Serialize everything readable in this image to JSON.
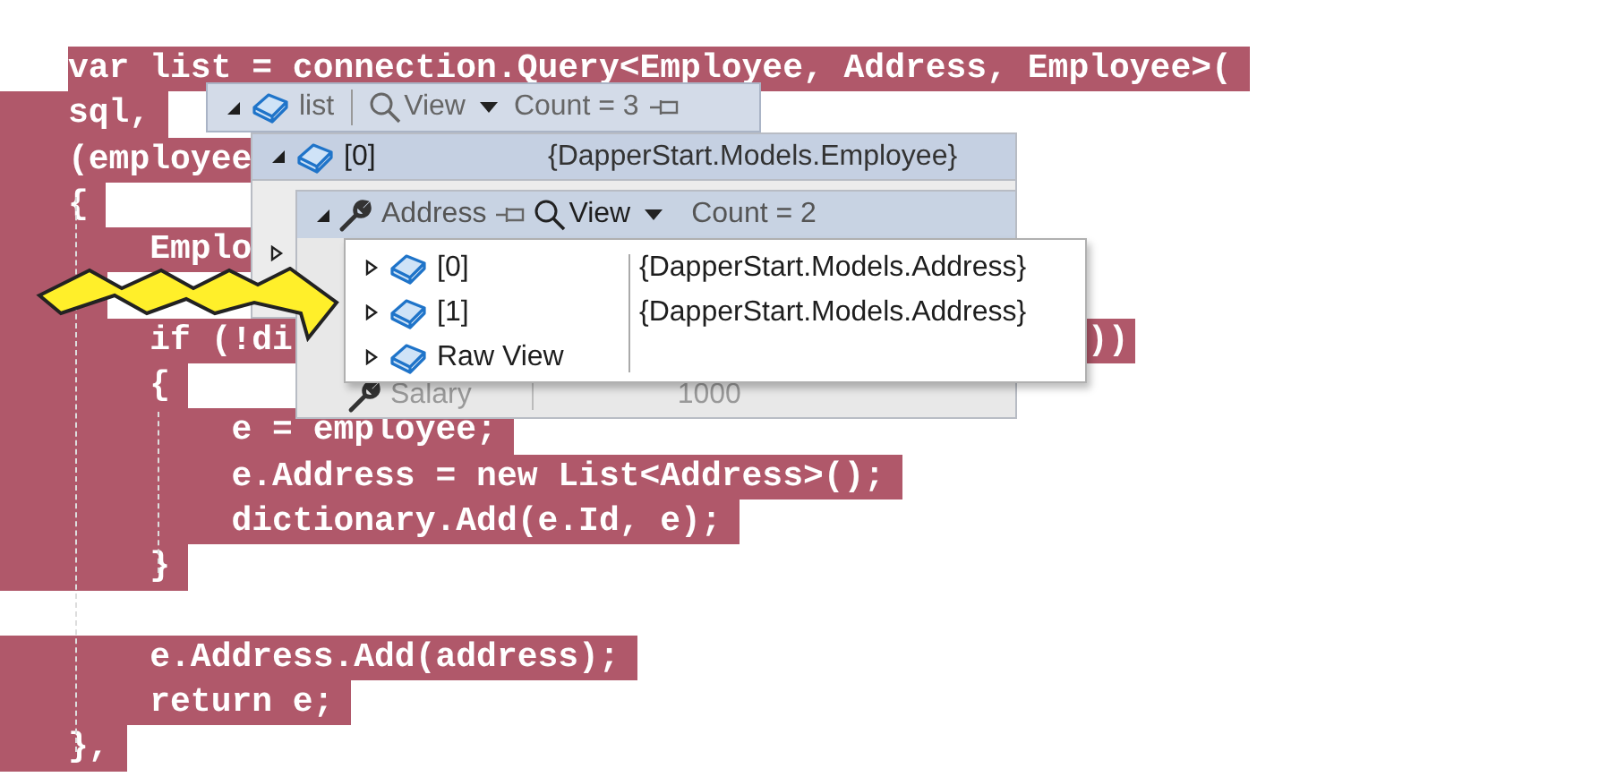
{
  "code_lines": [
    {
      "kind": "code",
      "text": "var list = connection.Query<Employee, Address, Employee>("
    },
    {
      "kind": "code",
      "text": "sql,"
    },
    {
      "kind": "code",
      "text": "(employee"
    },
    {
      "kind": "code",
      "text": "{"
    },
    {
      "kind": "code",
      "text": "    Emplo"
    },
    {
      "kind": "selected_blank"
    },
    {
      "kind": "code",
      "text": "    if (!di",
      "tail": "))"
    },
    {
      "kind": "code",
      "text": "    {"
    },
    {
      "kind": "code",
      "text": "        e = employee;"
    },
    {
      "kind": "code",
      "text": "        e.Address = new List<Address>();"
    },
    {
      "kind": "code",
      "text": "        dictionary.Add(e.Id, e);"
    },
    {
      "kind": "code",
      "text": "    }"
    },
    {
      "kind": "blank"
    },
    {
      "kind": "code",
      "text": "    e.Address.Add(address);"
    },
    {
      "kind": "code",
      "text": "    return e;"
    },
    {
      "kind": "code",
      "text": "},"
    }
  ],
  "datatip": {
    "name": "list",
    "expanded": true,
    "dimmed": true,
    "view_label": "View",
    "count": "Count = 3",
    "item": {
      "name": "[0]",
      "expanded": true,
      "selected": true,
      "value": "{DapperStart.Models.Employee}",
      "address": {
        "name": "Address",
        "expanded": true,
        "dimmed": false,
        "view_label": "View",
        "count": "Count = 2",
        "children": [
          {
            "name": "[0]",
            "expanded": false,
            "value": "{DapperStart.Models.Address}"
          },
          {
            "name": "[1]",
            "expanded": false,
            "value": "{DapperStart.Models.Address}"
          },
          {
            "name": "Raw View",
            "expanded": false
          }
        ]
      },
      "salary": {
        "name": "Salary",
        "dimmed": true,
        "value": "1000"
      }
    }
  }
}
